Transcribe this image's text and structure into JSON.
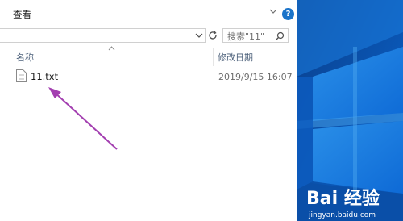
{
  "ribbon": {
    "tab_label": "查看"
  },
  "search": {
    "placeholder": "搜索\"11\""
  },
  "columns": {
    "name": "名称",
    "date_modified": "修改日期"
  },
  "files": [
    {
      "name": "11.txt",
      "date_modified": "2019/9/15 16:07"
    }
  ],
  "watermark": {
    "brand": "Bai 经验",
    "url": "jingyan.baidu.com"
  },
  "colors": {
    "accent": "#1a73c9",
    "annotation_arrow": "#a33fb0",
    "desktop_blue": "#0a63c9"
  }
}
